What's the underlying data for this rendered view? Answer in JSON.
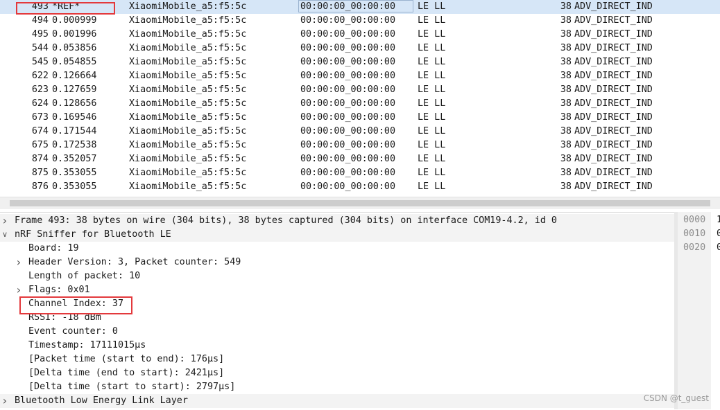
{
  "packet_list": {
    "rows": [
      {
        "no": "493",
        "time": "*REF*",
        "source": "XiaomiMobile_a5:f5:5c",
        "destination": "00:00:00_00:00:00",
        "protocol": "LE LL",
        "length": "38",
        "info": "ADV_DIRECT_IND",
        "selected": true
      },
      {
        "no": "494",
        "time": "0.000999",
        "source": "XiaomiMobile_a5:f5:5c",
        "destination": "00:00:00_00:00:00",
        "protocol": "LE LL",
        "length": "38",
        "info": "ADV_DIRECT_IND"
      },
      {
        "no": "495",
        "time": "0.001996",
        "source": "XiaomiMobile_a5:f5:5c",
        "destination": "00:00:00_00:00:00",
        "protocol": "LE LL",
        "length": "38",
        "info": "ADV_DIRECT_IND"
      },
      {
        "no": "544",
        "time": "0.053856",
        "source": "XiaomiMobile_a5:f5:5c",
        "destination": "00:00:00_00:00:00",
        "protocol": "LE LL",
        "length": "38",
        "info": "ADV_DIRECT_IND"
      },
      {
        "no": "545",
        "time": "0.054855",
        "source": "XiaomiMobile_a5:f5:5c",
        "destination": "00:00:00_00:00:00",
        "protocol": "LE LL",
        "length": "38",
        "info": "ADV_DIRECT_IND"
      },
      {
        "no": "622",
        "time": "0.126664",
        "source": "XiaomiMobile_a5:f5:5c",
        "destination": "00:00:00_00:00:00",
        "protocol": "LE LL",
        "length": "38",
        "info": "ADV_DIRECT_IND"
      },
      {
        "no": "623",
        "time": "0.127659",
        "source": "XiaomiMobile_a5:f5:5c",
        "destination": "00:00:00_00:00:00",
        "protocol": "LE LL",
        "length": "38",
        "info": "ADV_DIRECT_IND"
      },
      {
        "no": "624",
        "time": "0.128656",
        "source": "XiaomiMobile_a5:f5:5c",
        "destination": "00:00:00_00:00:00",
        "protocol": "LE LL",
        "length": "38",
        "info": "ADV_DIRECT_IND"
      },
      {
        "no": "673",
        "time": "0.169546",
        "source": "XiaomiMobile_a5:f5:5c",
        "destination": "00:00:00_00:00:00",
        "protocol": "LE LL",
        "length": "38",
        "info": "ADV_DIRECT_IND"
      },
      {
        "no": "674",
        "time": "0.171544",
        "source": "XiaomiMobile_a5:f5:5c",
        "destination": "00:00:00_00:00:00",
        "protocol": "LE LL",
        "length": "38",
        "info": "ADV_DIRECT_IND"
      },
      {
        "no": "675",
        "time": "0.172538",
        "source": "XiaomiMobile_a5:f5:5c",
        "destination": "00:00:00_00:00:00",
        "protocol": "LE LL",
        "length": "38",
        "info": "ADV_DIRECT_IND"
      },
      {
        "no": "874",
        "time": "0.352057",
        "source": "XiaomiMobile_a5:f5:5c",
        "destination": "00:00:00_00:00:00",
        "protocol": "LE LL",
        "length": "38",
        "info": "ADV_DIRECT_IND"
      },
      {
        "no": "875",
        "time": "0.353055",
        "source": "XiaomiMobile_a5:f5:5c",
        "destination": "00:00:00_00:00:00",
        "protocol": "LE LL",
        "length": "38",
        "info": "ADV_DIRECT_IND"
      },
      {
        "no": "876",
        "time": "0.353055",
        "source": "XiaomiMobile_a5:f5:5c",
        "destination": "00:00:00_00:00:00",
        "protocol": "LE LL",
        "length": "38",
        "info": "ADV_DIRECT_IND"
      }
    ]
  },
  "details": {
    "rows": [
      {
        "level": 0,
        "arrow": "right",
        "text": "Frame 493: 38 bytes on wire (304 bits), 38 bytes captured (304 bits) on interface COM19-4.2, id 0"
      },
      {
        "level": 0,
        "arrow": "down",
        "text": "nRF Sniffer for Bluetooth LE"
      },
      {
        "level": 1,
        "arrow": "",
        "text": "Board: 19"
      },
      {
        "level": 1,
        "arrow": "right",
        "text": "Header Version: 3, Packet counter: 549"
      },
      {
        "level": 1,
        "arrow": "",
        "text": "Length of packet: 10"
      },
      {
        "level": 1,
        "arrow": "right",
        "text": "Flags: 0x01"
      },
      {
        "level": 1,
        "arrow": "",
        "text": "Channel Index: 37"
      },
      {
        "level": 1,
        "arrow": "",
        "text": "RSSI: -18 dBm"
      },
      {
        "level": 1,
        "arrow": "",
        "text": "Event counter: 0"
      },
      {
        "level": 1,
        "arrow": "",
        "text": "Timestamp: 17111015µs"
      },
      {
        "level": 1,
        "arrow": "",
        "text": "[Packet time (start to end): 176µs]"
      },
      {
        "level": 1,
        "arrow": "",
        "text": "[Delta time (end to start): 2421µs]"
      },
      {
        "level": 1,
        "arrow": "",
        "text": "[Delta time (start to start): 2797µs]"
      },
      {
        "level": 0,
        "arrow": "right",
        "text": "Bluetooth Low Energy Link Layer"
      }
    ]
  },
  "hex": {
    "rows": [
      {
        "offset": "0000",
        "bytes": "1"
      },
      {
        "offset": "0010",
        "bytes": "0"
      },
      {
        "offset": "0020",
        "bytes": "0"
      }
    ]
  },
  "icons": {
    "collapsed": "chevron-right-icon",
    "expanded": "chevron-down-icon"
  },
  "colors": {
    "selected_row": "#d6e6f7",
    "highlight_box": "#e3393c",
    "alt_row": "#f3f3f3"
  },
  "watermark": "CSDN @t_guest"
}
